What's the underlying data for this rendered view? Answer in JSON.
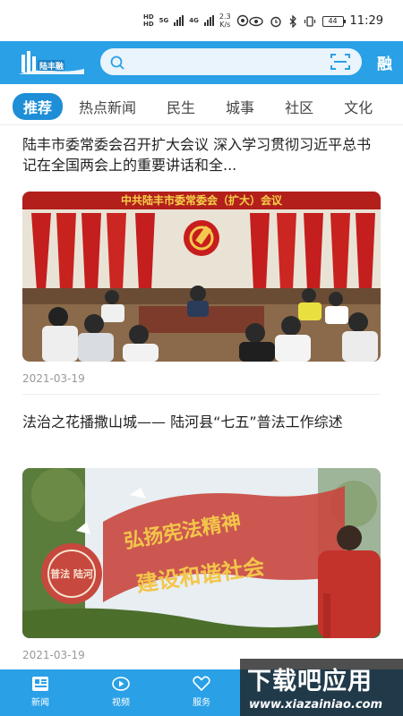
{
  "status_bar": {
    "hd_top": "HD",
    "hd_bottom": "HD",
    "net_top": "5G",
    "net_mid": "4G",
    "speed_value": "2.3",
    "speed_unit": "K/s",
    "battery": "44",
    "time": "11:29"
  },
  "header": {
    "logo_text": "陆丰融",
    "right_label": "融"
  },
  "tabs": [
    "推荐",
    "热点新闻",
    "民生",
    "城事",
    "社区",
    "文化"
  ],
  "articles": [
    {
      "title": "陆丰市委常委会召开扩大会议 深入学习贯彻习近平总书记在全国两会上的重要讲话和全...",
      "banner_text": "中共陆丰市委常委会（扩大）会议",
      "date": "2021-03-19"
    },
    {
      "title": "法治之花播撒山城—— 陆河县“七五”普法工作综述",
      "sign_text": "弘扬宪法精神",
      "sign_text2": "建设和谐社会",
      "seal_text": "普法 陆河",
      "date": "2021-03-19"
    }
  ],
  "bottom_nav": [
    {
      "label": "新闻",
      "icon": "news-icon"
    },
    {
      "label": "视频",
      "icon": "video-icon"
    },
    {
      "label": "服务",
      "icon": "service-icon"
    }
  ],
  "watermark": {
    "main": "下载吧应用",
    "sub": "www.xiazainiao.com"
  },
  "colors": {
    "brand": "#2aa0e6",
    "tab_active": "#1e8fd6"
  }
}
